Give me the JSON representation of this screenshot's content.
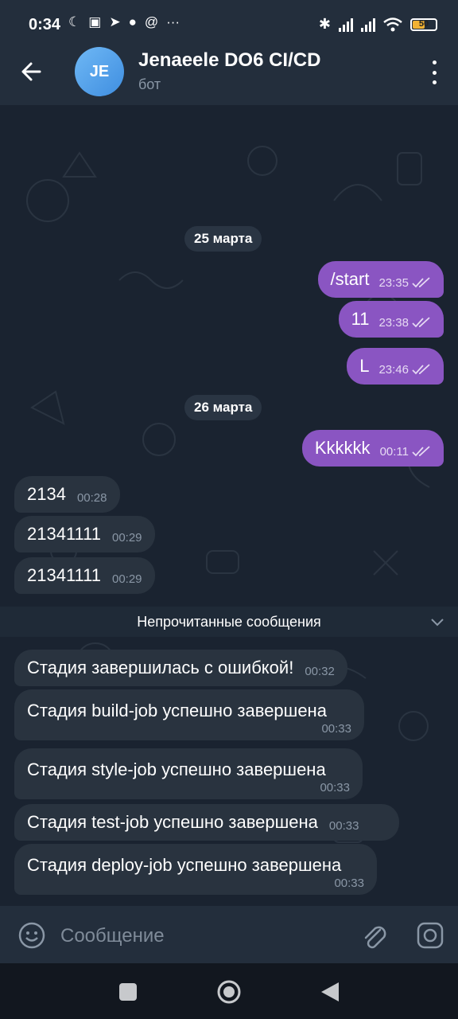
{
  "status_bar": {
    "time": "0:34",
    "battery": "50"
  },
  "header": {
    "avatar_initials": "JE",
    "title": "Jenaeele DO6 CI/CD",
    "subtitle": "бот"
  },
  "messages": [
    {
      "type": "date",
      "label": "25 марта"
    },
    {
      "type": "out",
      "text": "/start",
      "time": "23:35"
    },
    {
      "type": "out",
      "text": "11",
      "time": "23:38"
    },
    {
      "type": "out",
      "text": "L",
      "time": "23:46"
    },
    {
      "type": "date",
      "label": "26 марта"
    },
    {
      "type": "out",
      "text": "Kkkkkk",
      "time": "00:11"
    },
    {
      "type": "in",
      "text": "2134",
      "time": "00:28"
    },
    {
      "type": "in",
      "text": "21341111",
      "time": "00:29"
    },
    {
      "type": "in",
      "text": "21341111",
      "time": "00:29"
    },
    {
      "type": "in",
      "text": "Стадия   завершилась с ошибкой!",
      "time": "00:32"
    },
    {
      "type": "in",
      "text": "Стадия  build-job успешно завершена",
      "time": "00:33"
    },
    {
      "type": "in",
      "text": "Стадия  style-job успешно завершена",
      "time": "00:33"
    },
    {
      "type": "in",
      "text": "Стадия  test-job успешно завершена",
      "time": "00:33"
    },
    {
      "type": "in",
      "text": "Стадия  deploy-job успешно завершена",
      "time": "00:33"
    }
  ],
  "unread_label": "Непрочитанные сообщения",
  "composer": {
    "placeholder": "Сообщение"
  },
  "colors": {
    "accent_outgoing": "#8a55c2",
    "incoming": "#29333f",
    "background": "#1a2330",
    "header": "#232e3c"
  }
}
